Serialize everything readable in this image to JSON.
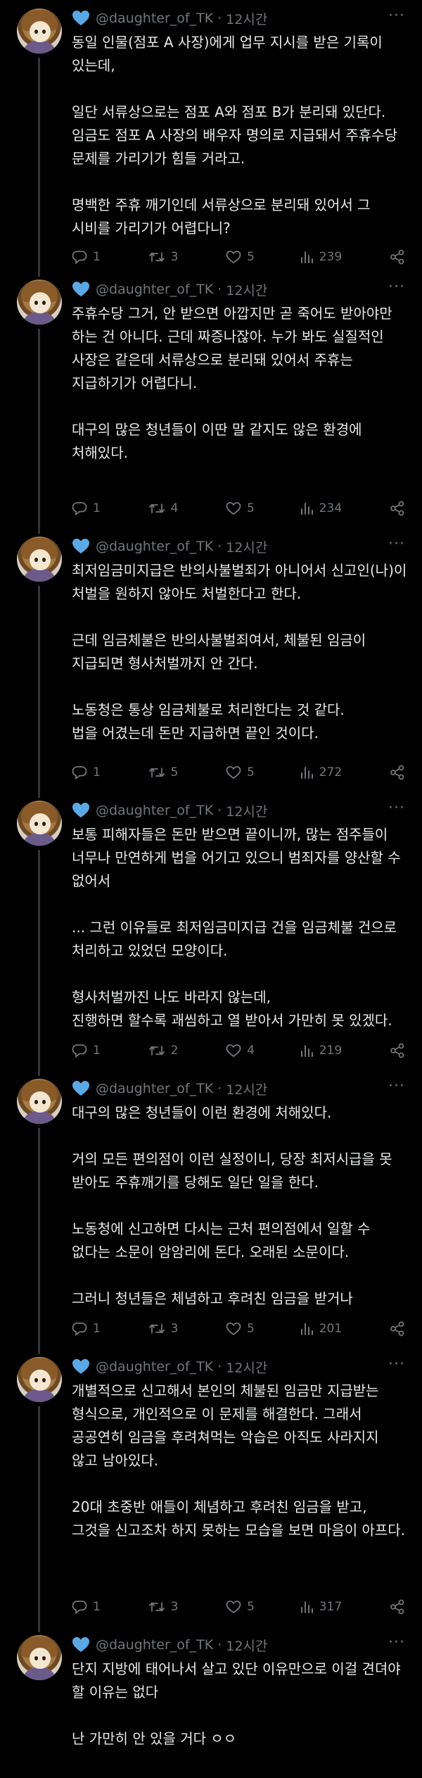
{
  "author": {
    "handle": "@daughter_of_TK",
    "time": "12시간",
    "separator": "·",
    "more": "···"
  },
  "tweets": [
    {
      "text": "동일 인물(점포 A 사장)에게 업무 지시를 받은 기록이 있는데,\n\n일단 서류상으로는 점포 A와 점포 B가 분리돼 있단다. 임금도 점포 A 사장의 배우자 명의로 지급돼서 주휴수당 문제를 가리기가 힘들 거라고.\n\n명백한 주휴 깨기인데 서류상으로 분리돼 있어서 그 시비를 가리기가 어렵다니?",
      "replies": "1",
      "retweets": "3",
      "likes": "5",
      "views": "239"
    },
    {
      "text": "주휴수당 그거, 안 받으면 아깝지만 곧 죽어도 받아야만 하는 건 아니다. 근데 짜증나잖아. 누가 봐도 실질적인 사장은 같은데 서류상으로 분리돼 있어서 주휴는 지급하기가 어렵다니.\n\n대구의 많은 청년들이 이딴 말 같지도 않은 환경에 처해있다.",
      "replies": "1",
      "retweets": "4",
      "likes": "5",
      "views": "234"
    },
    {
      "text": "최저임금미지급은 반의사불벌죄가 아니어서 신고인(나)이 처벌을 원하지 않아도 처벌한다고 한다.\n\n근데 임금체불은 반의사불벌죄여서, 체불된 임금이 지급되면 형사처벌까지 안 간다.\n\n노동청은 통상 임금체불로 처리한다는 것 같다.\n법을 어겼는데 돈만 지급하면 끝인 것이다.",
      "replies": "1",
      "retweets": "5",
      "likes": "5",
      "views": "272"
    },
    {
      "text": "보통 피해자들은 돈만 받으면 끝이니까, 많는 점주들이 너무나 만연하게 법을 어기고 있으니 범죄자를 양산할 수 없어서\n\n... 그런 이유들로 최저임금미지급 건을 임금체불 건으로 처리하고 있었던 모양이다.\n\n형사처벌까진 나도 바라지 않는데,\n진행하면 할수록 괘씸하고 열 받아서 가만히 못 있겠다.",
      "replies": "1",
      "retweets": "2",
      "likes": "4",
      "views": "219"
    },
    {
      "text": "대구의 많은 청년들이 이런 환경에 처해있다.\n\n거의 모든 편의점이 이런 실정이니, 당장 최저시급을 못 받아도 주휴깨기를 당해도 일단 일을 한다.\n\n노동청에 신고하면 다시는 근처 편의점에서 일할 수 없다는 소문이 암암리에 돈다. 오래된 소문이다.\n\n그러니 청년들은 체념하고 후려친 임금을 받거나",
      "replies": "1",
      "retweets": "3",
      "likes": "5",
      "views": "201"
    },
    {
      "text": "개별적으로 신고해서 본인의 체불된 임금만 지급받는 형식으로, 개인적으로 이 문제를 해결한다. 그래서 공공연히 임금을 후려쳐먹는 악습은 아직도 사라지지 않고 남아있다.\n\n20대 초중반 애들이 체념하고 후려친 임금을 받고, 그것을 신고조차 하지 못하는 모습을 보면 마음이 아프다.",
      "replies": "1",
      "retweets": "3",
      "likes": "5",
      "views": "317"
    },
    {
      "text": "단지 지방에 태어나서 살고 있단 이유만으로 이걸 견뎌야 할 이유는 없다\n\n난 가만히 안 있을 거다 ㅇㅇ",
      "replies": "",
      "retweets": "",
      "likes": "",
      "views": ""
    }
  ],
  "icons": [
    "reply-icon",
    "retweet-icon",
    "like-icon",
    "views-icon",
    "share-icon",
    "heart-icon"
  ],
  "colors": {
    "background": "#000000",
    "text": "#e7e9ea",
    "muted": "#71767b",
    "heart": "#5aa9e6",
    "line": "#333639"
  }
}
